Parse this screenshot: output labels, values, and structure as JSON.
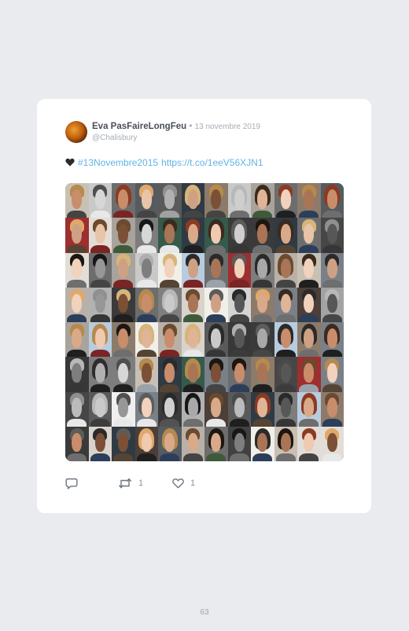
{
  "tweet": {
    "author_name": "Eva PasFaireLongFeu",
    "separator": "•",
    "date": "13 novembre 2019",
    "handle": "@Chalisbury",
    "emoji_icon": "black-heart-icon",
    "hashtag": "#13Novembre2015",
    "link": "https://t.co/1eeV56XJN1",
    "media": {
      "columns": 12,
      "rows": 8
    },
    "actions": {
      "reply_icon": "reply-icon",
      "retweet_icon": "retweet-icon",
      "retweet_count": "1",
      "like_icon": "heart-icon",
      "like_count": "1"
    }
  },
  "page": {
    "number": "63"
  },
  "colors": {
    "background": "#e9ebee",
    "card": "#ffffff",
    "link": "#5fb4e6",
    "muted": "#a7adb5",
    "name": "#4a4f57"
  }
}
